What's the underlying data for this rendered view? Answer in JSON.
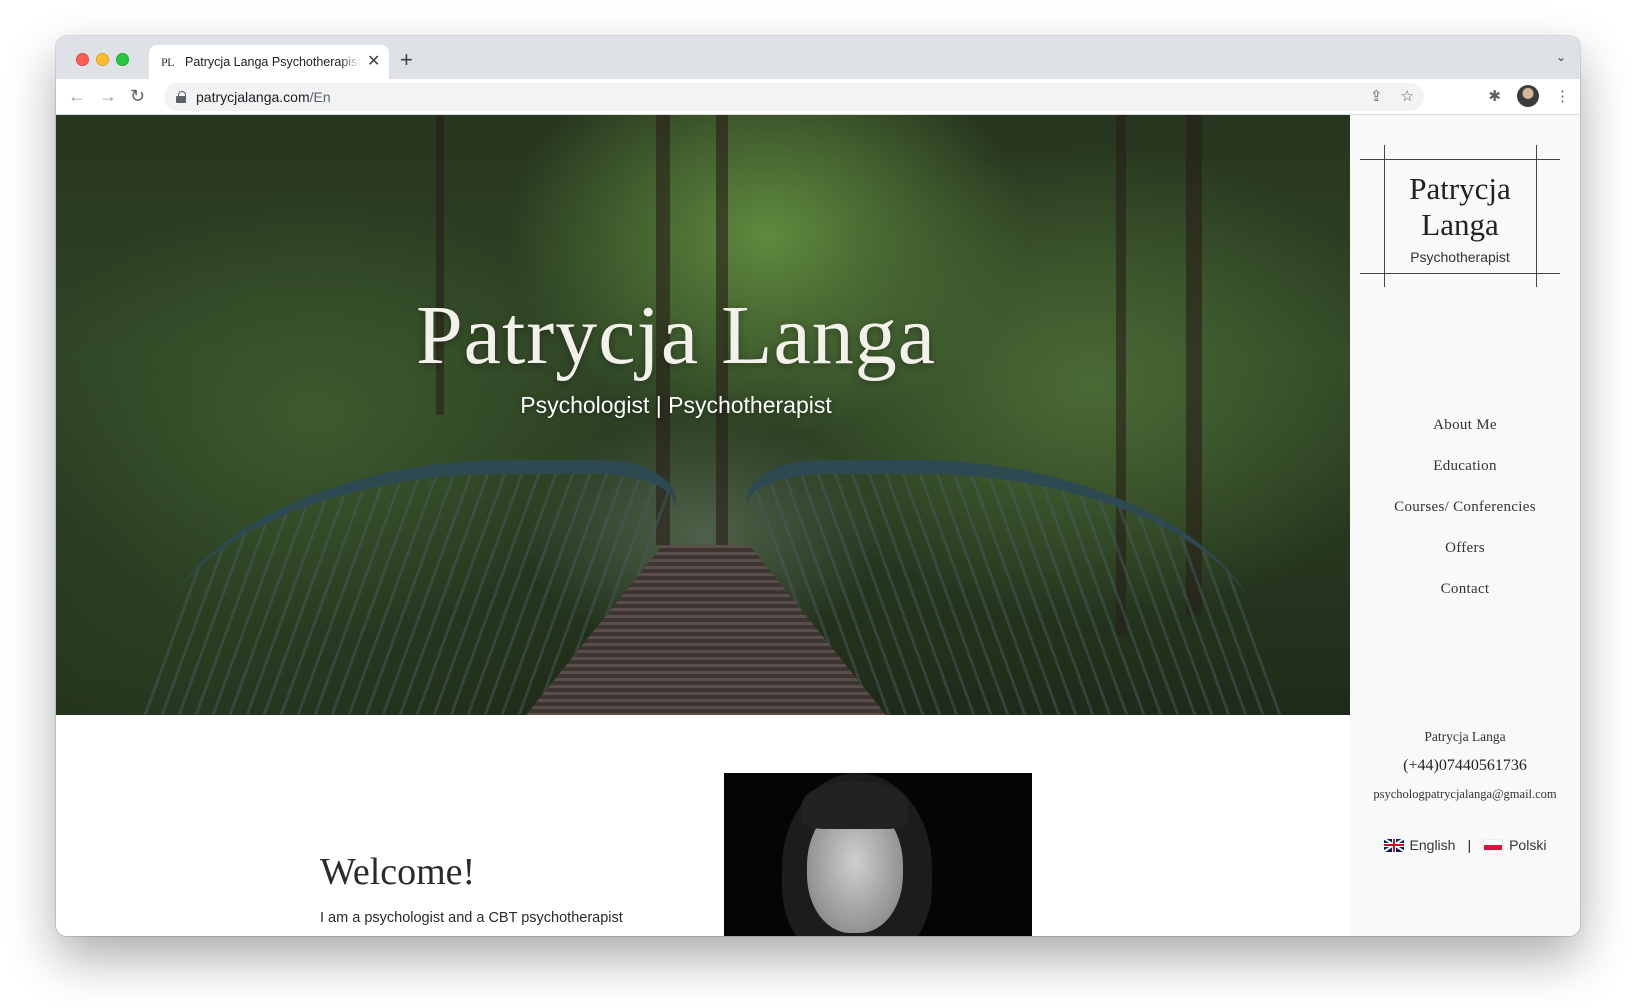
{
  "browser": {
    "tab": {
      "favicon_text": "PL",
      "title": "Patrycja Langa Psychotherapist"
    },
    "url": {
      "host": "patrycjalanga.com",
      "path": "/En"
    },
    "icons": [
      "back-icon",
      "forward-icon",
      "reload-icon",
      "lock-icon",
      "share-icon",
      "star-icon",
      "extensions-icon",
      "profile-avatar",
      "menu-icon"
    ]
  },
  "hero": {
    "title": "Patrycja Langa",
    "subtitle": "Psychologist | Psychotherapist"
  },
  "welcome": {
    "title": "Welcome!",
    "text": "I am a psychologist and a CBT psychotherapist"
  },
  "sidebar": {
    "logo": {
      "name_line1": "Patrycja",
      "name_line2": "Langa",
      "sub": "Psychotherapist"
    },
    "nav": [
      {
        "label": "About Me"
      },
      {
        "label": "Education"
      },
      {
        "label": "Courses/ Conferencies"
      },
      {
        "label": "Offers"
      },
      {
        "label": "Contact"
      }
    ],
    "contact": {
      "name": "Patrycja Langa",
      "phone": "(+44)07440561736",
      "email": "psychologpatrycjalanga@gmail.com"
    },
    "languages": {
      "english": "English",
      "separator": "|",
      "polish": "Polski"
    }
  },
  "colors": {
    "sidebar_bg": "#f9f9f9",
    "tabstrip_bg": "#dee1e6",
    "text_dark": "#2b2b2b"
  }
}
